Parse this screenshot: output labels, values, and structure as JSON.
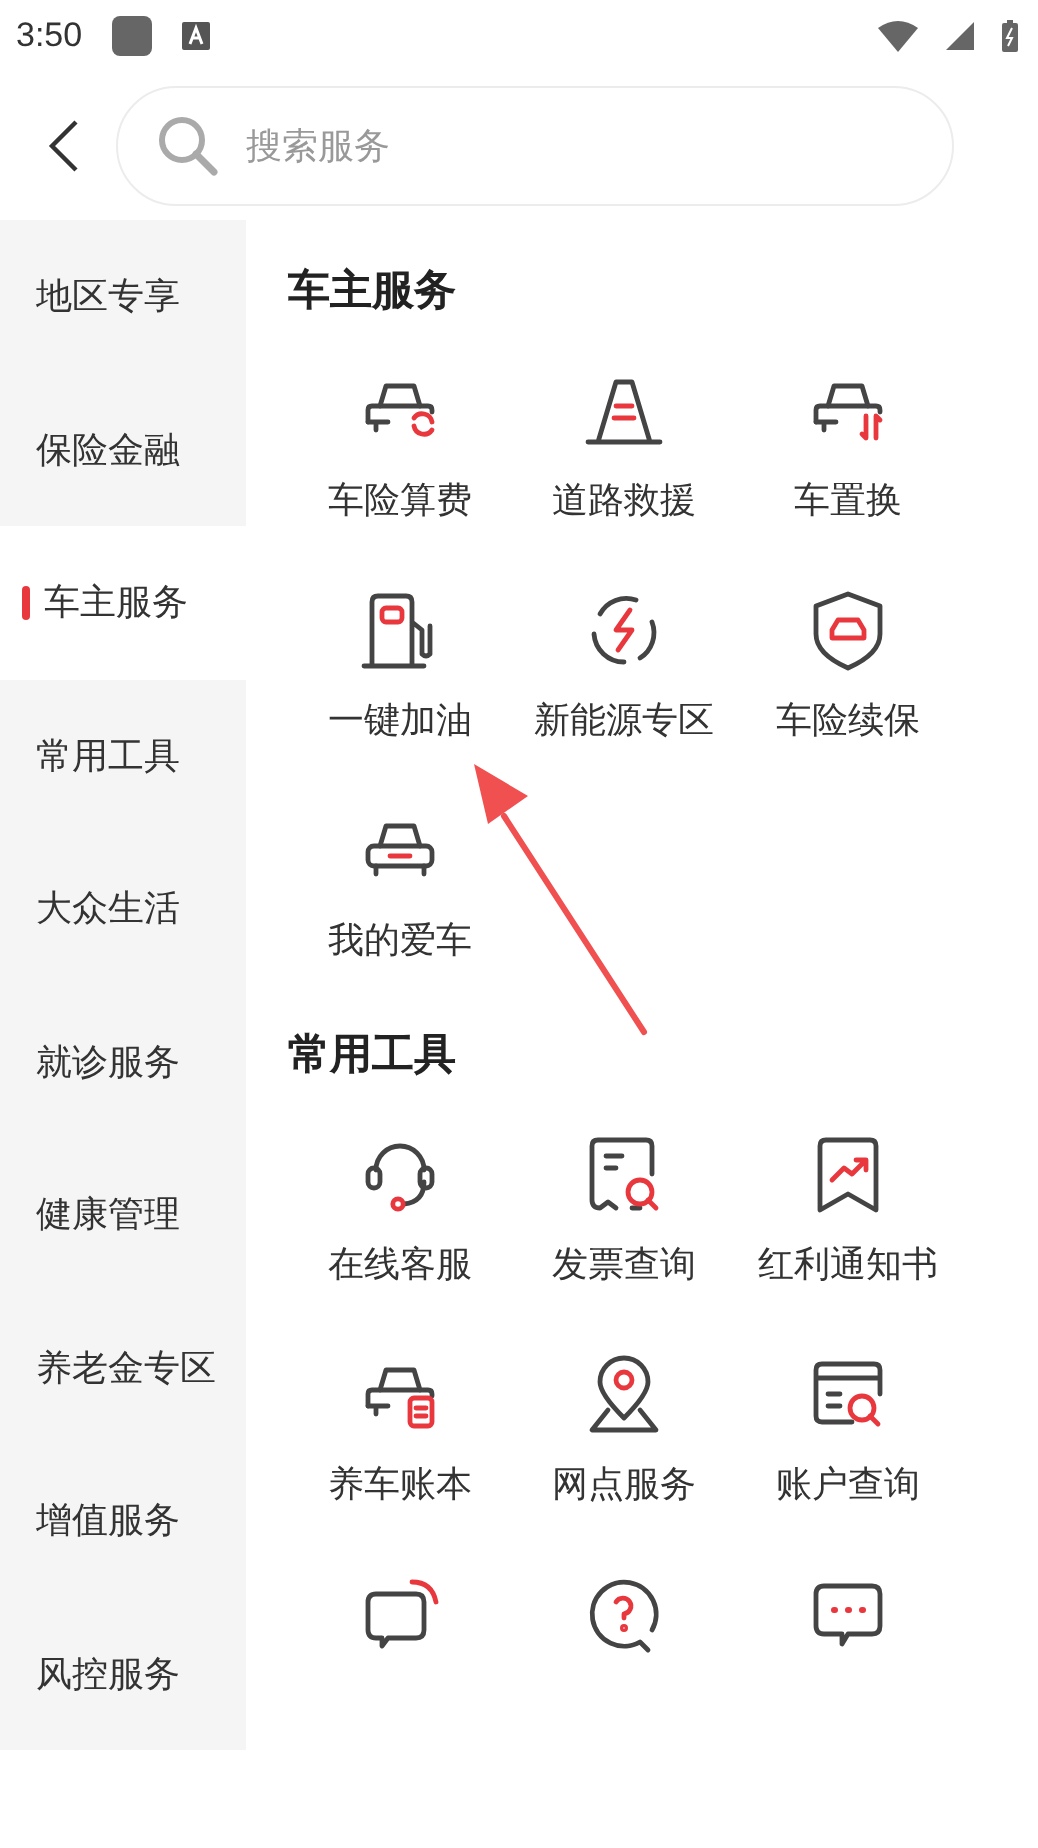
{
  "status_bar": {
    "time": "3:50"
  },
  "search": {
    "placeholder": "搜索服务"
  },
  "sidebar": {
    "items": [
      {
        "label": "地区专享",
        "selected": false
      },
      {
        "label": "保险金融",
        "selected": false
      },
      {
        "label": "车主服务",
        "selected": true
      },
      {
        "label": "常用工具",
        "selected": false
      },
      {
        "label": "大众生活",
        "selected": false
      },
      {
        "label": "就诊服务",
        "selected": false
      },
      {
        "label": "健康管理",
        "selected": false
      },
      {
        "label": "养老金专区",
        "selected": false
      },
      {
        "label": "增值服务",
        "selected": false
      },
      {
        "label": "风控服务",
        "selected": false
      }
    ]
  },
  "sections": [
    {
      "title": "车主服务",
      "items": [
        {
          "kind": "labeled",
          "label": "车险算费"
        },
        {
          "kind": "labeled",
          "label": "道路救援"
        },
        {
          "kind": "labeled",
          "label": "车置换"
        },
        {
          "kind": "labeled",
          "label": "一键加油"
        },
        {
          "kind": "labeled",
          "label": "新能源专区"
        },
        {
          "kind": "labeled",
          "label": "车险续保"
        },
        {
          "kind": "labeled",
          "label": "我的爱车"
        }
      ]
    },
    {
      "title": "常用工具",
      "items": [
        {
          "kind": "labeled",
          "label": "在线客服"
        },
        {
          "kind": "labeled",
          "label": "发票查询"
        },
        {
          "kind": "labeled",
          "label": "红利通知书"
        },
        {
          "kind": "labeled",
          "label": "养车账本"
        },
        {
          "kind": "labeled",
          "label": "网点服务"
        },
        {
          "kind": "labeled",
          "label": "账户查询"
        },
        {
          "kind": "icon_only"
        },
        {
          "kind": "icon_only"
        },
        {
          "kind": "icon_only"
        }
      ]
    }
  ]
}
